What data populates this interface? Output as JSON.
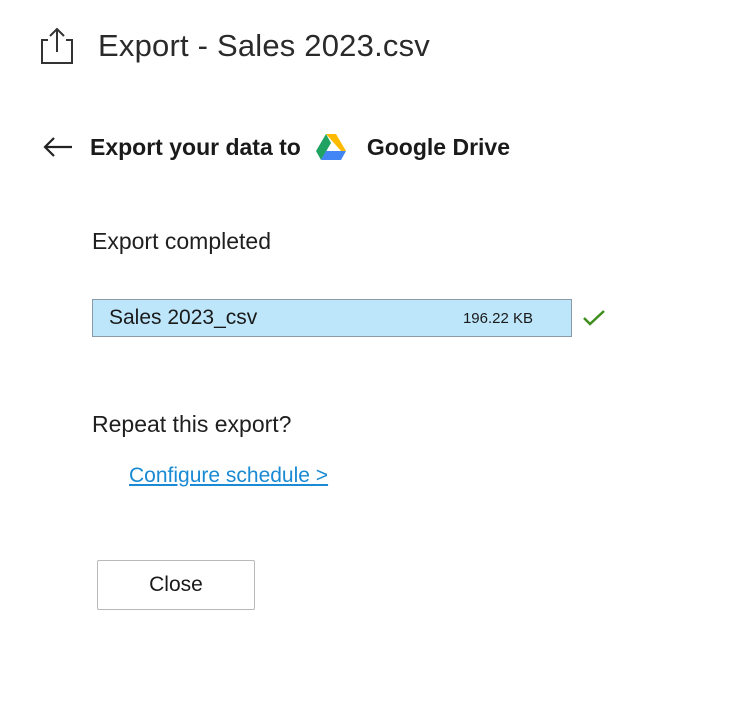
{
  "header": {
    "icon": "export-icon",
    "title": "Export - Sales 2023.csv"
  },
  "destination": {
    "back_icon": "back-arrow-icon",
    "label": "Export your data to",
    "service_icon": "google-drive-icon",
    "service_name": "Google Drive"
  },
  "status": {
    "text": "Export completed"
  },
  "file": {
    "name": "Sales 2023_csv",
    "size": "196.22 KB",
    "status_icon": "checkmark-icon"
  },
  "repeat": {
    "question": "Repeat this export?",
    "link_label": "Configure schedule >"
  },
  "actions": {
    "close_label": "Close"
  },
  "colors": {
    "file_bg": "#bde6fb",
    "link": "#1a8ad4",
    "check": "#3f8f1f",
    "drive_green": "#1ea362",
    "drive_yellow": "#ffba00",
    "drive_blue": "#4285f4"
  }
}
